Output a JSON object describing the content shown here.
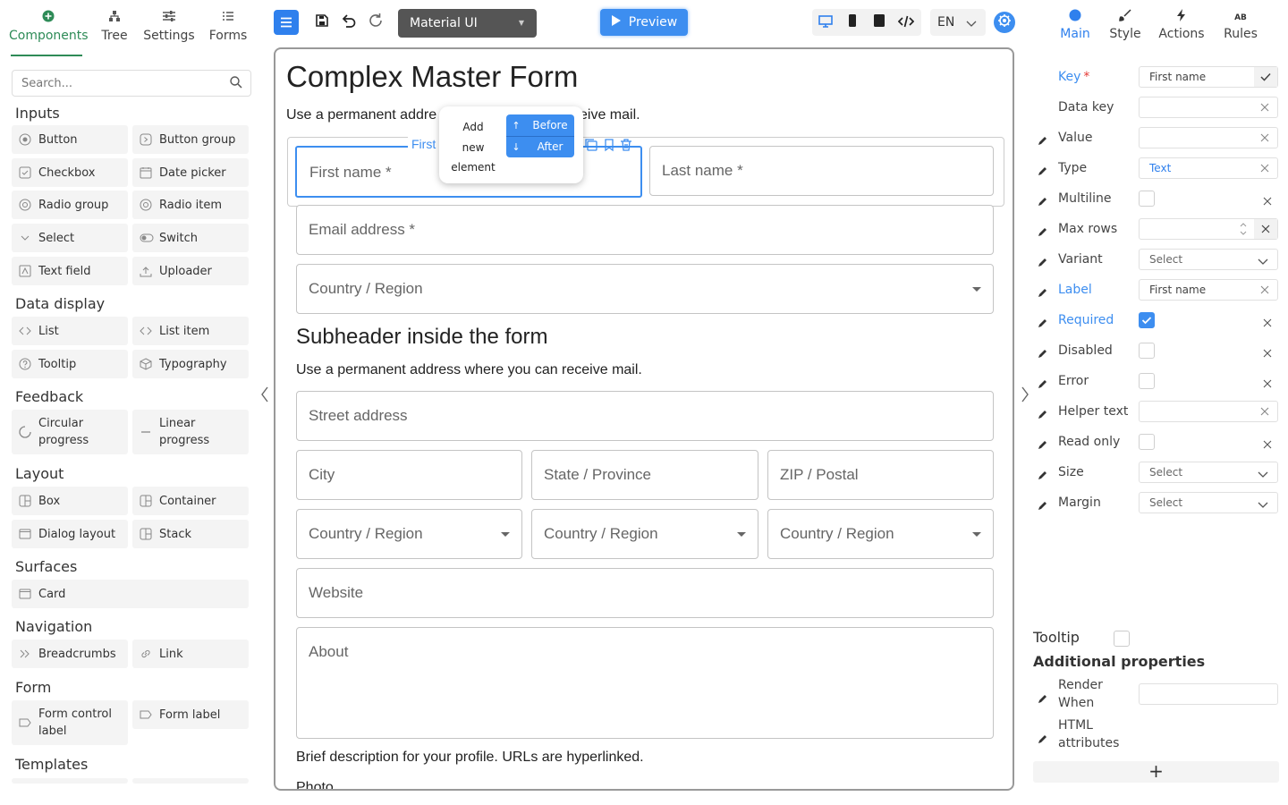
{
  "left_tabs": [
    {
      "label": "Components",
      "icon": "plus-circle-icon"
    },
    {
      "label": "Tree",
      "icon": "tree-icon"
    },
    {
      "label": "Settings",
      "icon": "sliders-icon"
    },
    {
      "label": "Forms",
      "icon": "list-icon"
    }
  ],
  "search": {
    "placeholder": "Search..."
  },
  "categories": {
    "inputs": "Inputs",
    "data_display": "Data display",
    "feedback": "Feedback",
    "layout": "Layout",
    "surfaces": "Surfaces",
    "navigation": "Navigation",
    "form": "Form",
    "templates": "Templates"
  },
  "components": {
    "button": "Button",
    "button_group": "Button group",
    "checkbox": "Checkbox",
    "date_picker": "Date picker",
    "radio_group": "Radio group",
    "radio_item": "Radio item",
    "select": "Select",
    "switch": "Switch",
    "text_field": "Text field",
    "uploader": "Uploader",
    "list": "List",
    "list_item": "List item",
    "tooltip": "Tooltip",
    "typography": "Typography",
    "circular_progress": "Circular progress",
    "linear_progress": "Linear progress",
    "box": "Box",
    "container": "Container",
    "dialog_layout": "Dialog layout",
    "stack": "Stack",
    "card": "Card",
    "breadcrumbs": "Breadcrumbs",
    "link": "Link",
    "form_control_label": "Form control label",
    "form_label": "Form label"
  },
  "toolbar": {
    "theme": "Material UI",
    "preview": "Preview",
    "language": "EN"
  },
  "form": {
    "title": "Complex Master Form",
    "intro_left": "Use a permanent addre",
    "intro_right": "eive mail.",
    "selected_label": "First",
    "first_name": "First name *",
    "last_name": "Last name *",
    "email": "Email address *",
    "country": "Country / Region",
    "subheader": "Subheader inside the form",
    "sub_text": "Use a permanent address where you can receive mail.",
    "street": "Street address",
    "city": "City",
    "state": "State / Province",
    "zip": "ZIP / Postal",
    "country_a": "Country / Region",
    "country_b": "Country / Region",
    "country_c": "Country / Region",
    "website": "Website",
    "about": "About",
    "about_help": "Brief description for your profile. URLs are hyperlinked.",
    "photo": "Photo"
  },
  "add_popup": {
    "line1": "Add",
    "line2": "new",
    "line3": "element",
    "before": "Before",
    "after": "After"
  },
  "right_tabs": [
    {
      "label": "Main",
      "icon": "circle-icon"
    },
    {
      "label": "Style",
      "icon": "brush-icon"
    },
    {
      "label": "Actions",
      "icon": "lightning-icon"
    },
    {
      "label": "Rules",
      "icon": "ab-icon"
    }
  ],
  "props": {
    "key_label": "Key",
    "key_value": "First name",
    "data_key_label": "Data key",
    "value_label": "Value",
    "type_label": "Type",
    "type_value": "Text",
    "multiline_label": "Multiline",
    "max_rows_label": "Max rows",
    "variant_label": "Variant",
    "variant_value": "Select",
    "label_label": "Label",
    "label_value": "First name",
    "required_label": "Required",
    "disabled_label": "Disabled",
    "error_label": "Error",
    "helper_label": "Helper text",
    "readonly_label": "Read only",
    "size_label": "Size",
    "size_value": "Select",
    "margin_label": "Margin",
    "margin_value": "Select"
  },
  "right_bottom": {
    "tooltip": "Tooltip",
    "additional": "Additional properties",
    "render_when": "Render When",
    "html_attrs": "HTML attributes",
    "add": "+"
  },
  "colors": {
    "accent": "#3d8ef0",
    "green": "#2e8b57"
  }
}
